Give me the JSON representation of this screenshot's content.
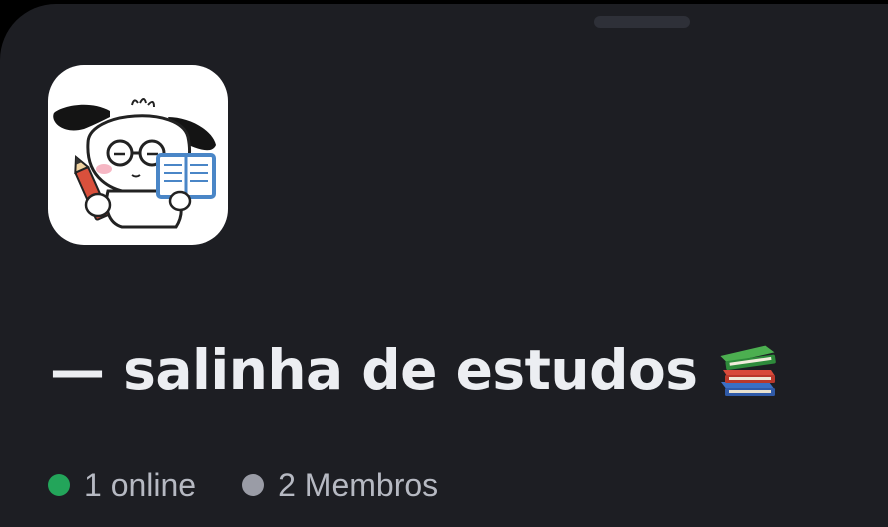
{
  "server": {
    "name": "— salinha de estudos",
    "name_emoji": "books-icon",
    "icon": "puppy-studying-avatar"
  },
  "stats": {
    "online": "1 online",
    "members": "2 Membros"
  },
  "colors": {
    "background": "#1d1e23",
    "online_dot": "#23a55a",
    "members_dot": "#9a9ca6",
    "title_text": "#eceef2",
    "stat_text": "#b6b9c2"
  }
}
